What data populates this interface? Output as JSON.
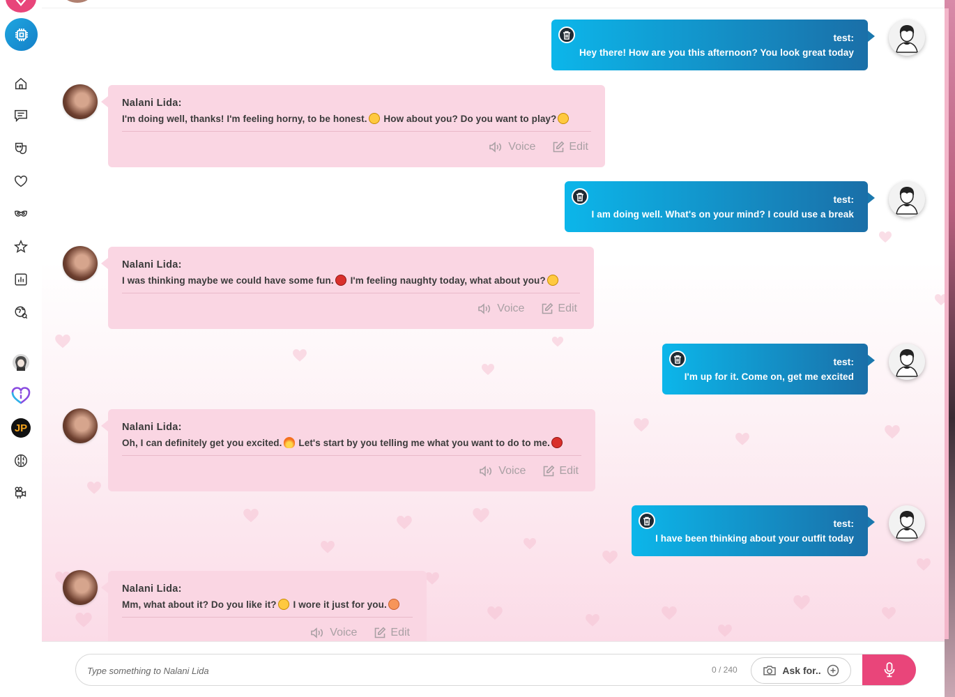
{
  "sidebar": {
    "items": [
      {
        "icon": "home-icon"
      },
      {
        "icon": "chat-icon"
      },
      {
        "icon": "masks-icon"
      },
      {
        "icon": "heart-icon"
      },
      {
        "icon": "mask-icon"
      },
      {
        "icon": "star-icon"
      },
      {
        "icon": "stats-icon"
      },
      {
        "icon": "globe-icon"
      },
      {
        "icon": "anime-avatar-icon"
      },
      {
        "icon": "heart-info-icon"
      },
      {
        "icon": "jp-icon",
        "label": "JP"
      },
      {
        "icon": "brain-icon"
      },
      {
        "icon": "camera-icon"
      }
    ]
  },
  "messages": [
    {
      "role": "user",
      "name": "test:",
      "text": "Hey there! How are you this afternoon? You look great today"
    },
    {
      "role": "bot",
      "name": "Nalani Lida:",
      "text_a": "I'm doing well, thanks! I'm feeling horny, to be honest.",
      "emoji_a": "smile-emoji",
      "text_b": " How about you? Do you want to play?",
      "emoji_b": "smirk-emoji",
      "voice": "Voice",
      "edit": "Edit"
    },
    {
      "role": "user",
      "name": "test:",
      "text": "I am doing well. What's on your mind? I could use a break"
    },
    {
      "role": "bot",
      "name": "Nalani Lida:",
      "text_a": "I was thinking maybe we could have some fun.",
      "emoji_a": "devil-emoji",
      "text_b": " I'm feeling naughty today, what about you?",
      "emoji_b": "smile-emoji",
      "voice": "Voice",
      "edit": "Edit"
    },
    {
      "role": "user",
      "name": "test:",
      "text": "I'm up for it. Come on, get me excited"
    },
    {
      "role": "bot",
      "name": "Nalani Lida:",
      "text_a": "Oh, I can definitely get you excited.",
      "emoji_a": "fire-emoji",
      "text_b": " Let's start by you telling me what you want to do to me.",
      "emoji_b": "devil-emoji",
      "voice": "Voice",
      "edit": "Edit"
    },
    {
      "role": "user",
      "name": "test:",
      "text": "I have been thinking about your outfit today"
    },
    {
      "role": "bot",
      "name": "Nalani Lida:",
      "text_a": "Mm, what about it? Do you like it?",
      "emoji_a": "smirk-emoji",
      "text_b": " I wore it just for you.",
      "emoji_b": "peach-emoji",
      "voice": "Voice",
      "edit": "Edit"
    }
  ],
  "input": {
    "placeholder": "Type something to Nalani Lida",
    "counter": "0 / 240",
    "ask_label": "Ask for.."
  },
  "colors": {
    "user_bubble_start": "#0cb6ea",
    "user_bubble_end": "#1a6fa8",
    "bot_bubble": "#fad6e3",
    "accent": "#e9457a"
  }
}
